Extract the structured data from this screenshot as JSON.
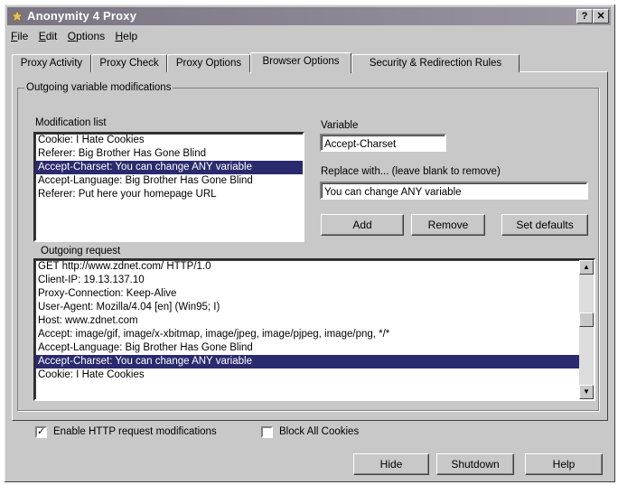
{
  "window": {
    "title": "Anonymity 4 Proxy",
    "help_btn": "?",
    "close_btn": "✕"
  },
  "menu": [
    {
      "key": "F",
      "rest": "ile"
    },
    {
      "key": "E",
      "rest": "dit"
    },
    {
      "key": "O",
      "rest": "ptions"
    },
    {
      "key": "H",
      "rest": "elp"
    }
  ],
  "tabs": [
    "Proxy Activity",
    "Proxy Check",
    "Proxy Options",
    "Browser Options",
    "Security & Redirection Rules"
  ],
  "active_tab": "Browser Options",
  "group_title": "Outgoing variable modifications",
  "modification_list": {
    "label": "Modification list",
    "items": [
      "Cookie: I Hate Cookies",
      "Referer: Big Brother Has Gone Blind",
      "Accept-Charset: You can change ANY variable",
      "Accept-Language: Big Brother Has Gone Blind",
      "Referer: Put here your homepage URL"
    ],
    "selected_index": 2
  },
  "variable": {
    "label": "Variable",
    "value": "Accept-Charset"
  },
  "replace": {
    "label": "Replace with... (leave blank to remove)",
    "value": "You can change ANY variable"
  },
  "buttons": {
    "add": "Add",
    "remove": "Remove",
    "set_defaults": "Set defaults"
  },
  "outgoing_request": {
    "label": "Outgoing request",
    "lines": [
      "GET http://www.zdnet.com/ HTTP/1.0",
      "Client-IP: 19.13.137.10",
      "Proxy-Connection: Keep-Alive",
      "User-Agent: Mozilla/4.04 [en] (Win95; I)",
      "Host: www.zdnet.com",
      "Accept: image/gif, image/x-xbitmap, image/jpeg, image/pjpeg, image/png, */*",
      "Accept-Language: Big Brother Has Gone Blind",
      "Accept-Charset: You can change ANY variable",
      "Cookie: I Hate Cookies"
    ],
    "selected_index": 7
  },
  "options": {
    "enable_http_mod": {
      "label": "Enable HTTP request modifications",
      "checked": true
    },
    "block_cookies": {
      "label": "Block All Cookies",
      "checked": false
    }
  },
  "footer_buttons": {
    "hide": "Hide",
    "shutdown": "Shutdown",
    "help": "Help"
  },
  "colors": {
    "titlebar": "#8d8894",
    "face": "#c8c8c8",
    "selection": "#2a2a6e"
  }
}
